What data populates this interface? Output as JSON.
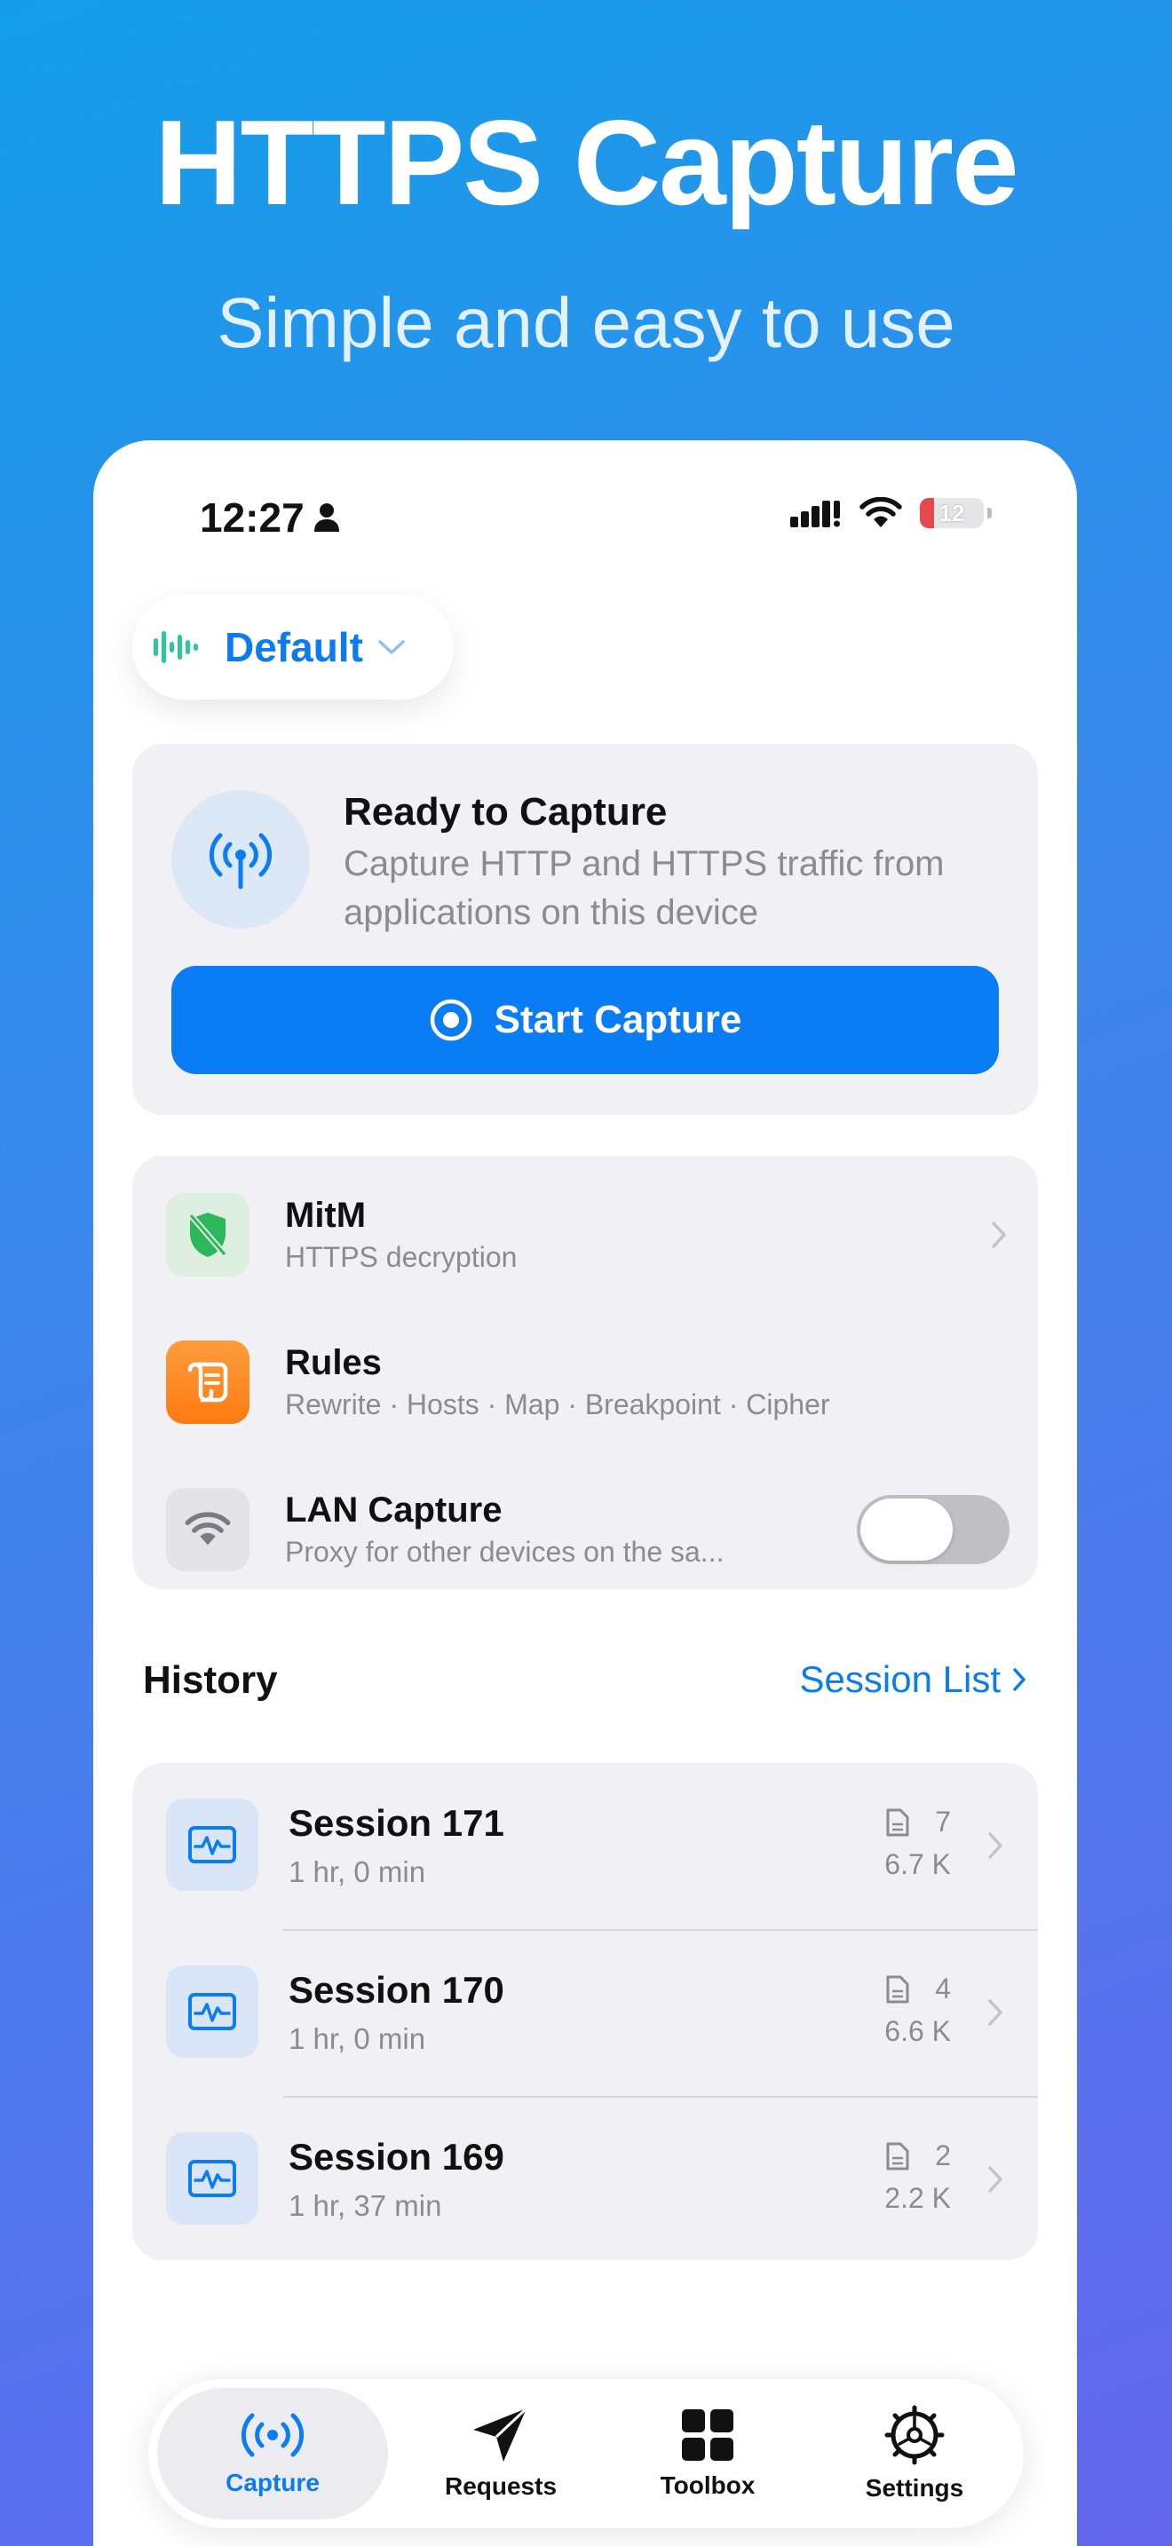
{
  "hero": {
    "title": "HTTPS Capture",
    "subtitle": "Simple and easy to use"
  },
  "status_bar": {
    "time": "12:27",
    "battery": "12"
  },
  "profile": {
    "label": "Default"
  },
  "ready": {
    "title": "Ready to Capture",
    "description": "Capture HTTP and HTTPS traffic from applications on this device",
    "button_label": "Start Capture"
  },
  "tools": [
    {
      "name": "MitM",
      "subtitle": "HTTPS decryption"
    },
    {
      "name": "Rules",
      "subtitle": "Rewrite · Hosts · Map · Breakpoint · Cipher"
    },
    {
      "name": "LAN Capture",
      "subtitle": "Proxy for other devices on the sa...",
      "enabled": false
    }
  ],
  "history": {
    "title": "History",
    "link_label": "Session List",
    "sessions": [
      {
        "name": "Session 171",
        "duration": "1 hr, 0 min",
        "count": "7",
        "size": "6.7 K"
      },
      {
        "name": "Session 170",
        "duration": "1 hr, 0 min",
        "count": "4",
        "size": "6.6 K"
      },
      {
        "name": "Session 169",
        "duration": "1 hr, 37 min",
        "count": "2",
        "size": "2.2 K"
      }
    ]
  },
  "tabs": [
    {
      "label": "Capture",
      "icon": "antenna-icon",
      "active": true
    },
    {
      "label": "Requests",
      "icon": "paper-plane-icon",
      "active": false
    },
    {
      "label": "Toolbox",
      "icon": "grid-icon",
      "active": false
    },
    {
      "label": "Settings",
      "icon": "gear-icon",
      "active": false
    }
  ],
  "colors": {
    "accent": "#0a7cf4",
    "mitm": "#2db65a",
    "rules": "#ff8a1e"
  }
}
